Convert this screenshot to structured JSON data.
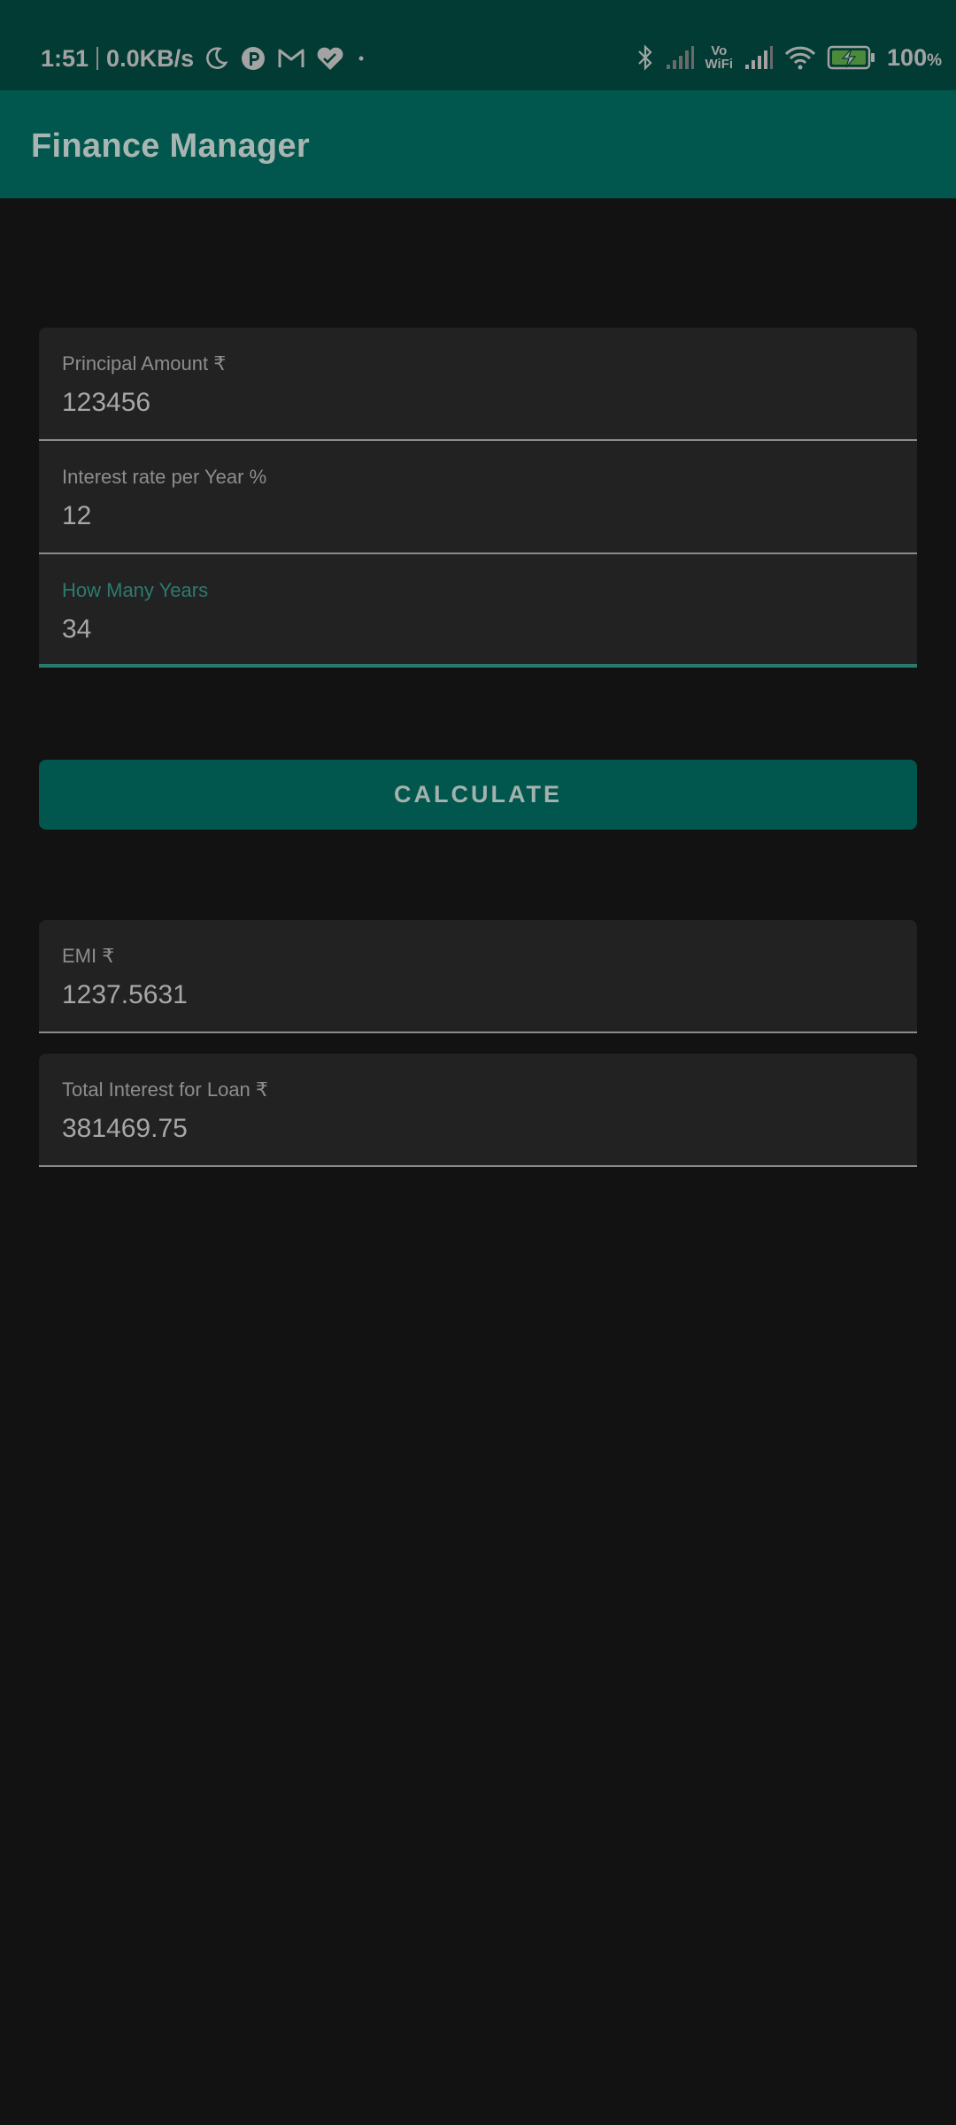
{
  "status_bar": {
    "time": "1:51",
    "net_speed": "0.0KB/s",
    "vowifi_top": "Vo",
    "vowifi_bottom": "WiFi",
    "battery": "100",
    "battery_unit": "%",
    "icons_left": [
      "moon-icon",
      "p-app-icon",
      "gmail-icon",
      "heart-icon",
      "dot-icon"
    ],
    "icons_right": [
      "bluetooth-icon",
      "signal-icon",
      "vowifi-icon",
      "signal-icon",
      "wifi-icon",
      "battery-charging-icon"
    ]
  },
  "app_bar": {
    "title": "Finance Manager"
  },
  "inputs": {
    "principal": {
      "label": "Principal Amount ₹",
      "value": "123456"
    },
    "interest": {
      "label": "Interest rate per Year %",
      "value": "12"
    },
    "years": {
      "label": "How Many Years",
      "value": "34"
    }
  },
  "calculate_button": {
    "label": "CALCULATE"
  },
  "results": {
    "emi": {
      "label": "EMI ₹",
      "value": "1237.5631"
    },
    "total_interest": {
      "label": "Total Interest for Loan ₹",
      "value": "381469.75"
    }
  },
  "colors": {
    "status_bar_bg": "#023b33",
    "app_bar_bg": "#01574d",
    "background": "#121212",
    "field_bg": "#222222",
    "accent": "#2a7a6c"
  }
}
